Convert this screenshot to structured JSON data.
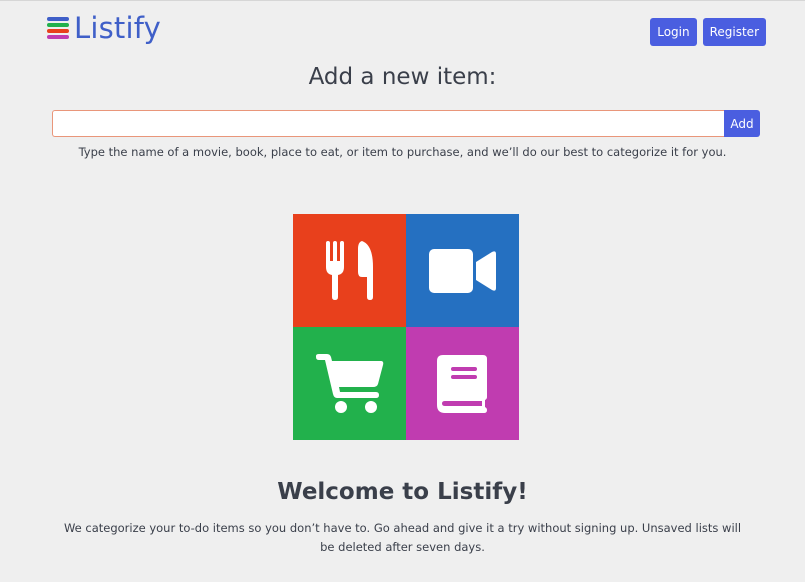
{
  "brand": {
    "name": "Listify",
    "icon": "stacked-lines-icon",
    "stripe_colors": [
      "#3f5fc8",
      "#22b14c",
      "#e8401c",
      "#c03cb0"
    ]
  },
  "nav": {
    "login_label": "Login",
    "register_label": "Register"
  },
  "add_item": {
    "heading": "Add a new item:",
    "input_value": "",
    "placeholder": "",
    "button_label": "Add",
    "hint": "Type the name of a movie, book, place to eat, or item to purchase, and we’ll do our best to categorize it for you."
  },
  "categories": [
    {
      "name": "food",
      "icon": "fork-knife-icon",
      "color": "#e8401c"
    },
    {
      "name": "movie",
      "icon": "video-camera-icon",
      "color": "#2570c1"
    },
    {
      "name": "purchase",
      "icon": "shopping-cart-icon",
      "color": "#22b14c"
    },
    {
      "name": "book",
      "icon": "book-icon",
      "color": "#c03cb0"
    }
  ],
  "welcome": {
    "title": "Welcome to Listify!",
    "text": "We categorize your to-do items so you don’t have to. Go ahead and give it a try without signing up. Unsaved lists will be deleted after seven days."
  },
  "colors": {
    "accent": "#4a5ee0",
    "brand_text": "#3f5fc8",
    "background": "#efefef",
    "input_border": "#e9967a"
  }
}
